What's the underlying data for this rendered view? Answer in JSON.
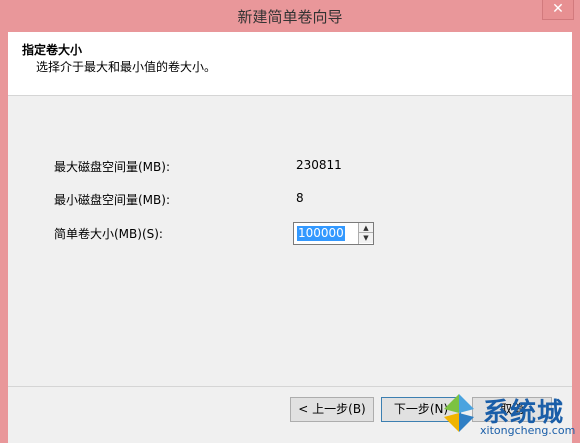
{
  "window": {
    "title": "新建简单卷向导",
    "close_glyph": "✕"
  },
  "header": {
    "title": "指定卷大小",
    "subtitle": "选择介于最大和最小值的卷大小。"
  },
  "fields": [
    {
      "label": "最大磁盘空间量(MB):",
      "value": "230811"
    },
    {
      "label": "最小磁盘空间量(MB):",
      "value": "8"
    }
  ],
  "size_field": {
    "label": "简单卷大小(MB)(S):",
    "value": "100000"
  },
  "buttons": {
    "back": "< 上一步(B)",
    "next": "下一步(N)",
    "cancel": "取消"
  },
  "watermark": {
    "text": "系统城",
    "url": "xitongcheng.com"
  },
  "colors": {
    "titlebar": "#e9979a",
    "selection": "#3399ff",
    "watermark": "#1a5ea8"
  }
}
